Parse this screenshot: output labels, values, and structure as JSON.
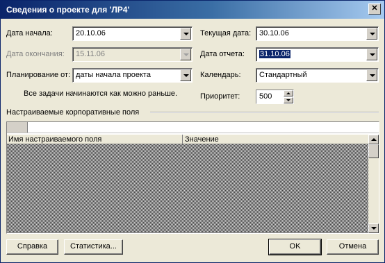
{
  "window": {
    "title": "Сведения о проекте для 'ЛР4'",
    "close_glyph": "✕"
  },
  "fields": {
    "start_date": {
      "label": "Дата начала:",
      "value": "20.10.06"
    },
    "finish_date": {
      "label": "Дата окончания:",
      "value": "15.11.06",
      "disabled": true
    },
    "schedule_from": {
      "label": "Планирование от:",
      "value": "даты начала проекта"
    },
    "current_date": {
      "label": "Текущая дата:",
      "value": "30.10.06"
    },
    "status_date": {
      "label": "Дата отчета:",
      "value": "31.10.06"
    },
    "calendar": {
      "label": "Календарь:",
      "value": "Стандартный"
    },
    "priority": {
      "label": "Приоритет:",
      "value": "500"
    }
  },
  "schedule_note": "Все задачи начинаются как можно раньше.",
  "custom_fields": {
    "group_label": "Настраиваемые корпоративные поля",
    "columns": [
      "Имя настраиваемого поля",
      "Значение"
    ]
  },
  "buttons": {
    "help": "Справка",
    "statistics": "Статистика...",
    "ok": "OK",
    "cancel": "Отмена"
  },
  "colors": {
    "title_start": "#0a246a",
    "title_end": "#a6caf0",
    "dialog_bg": "#ece9d8",
    "selection": "#0a246a"
  },
  "icons": {
    "close": "close-icon",
    "dropdown": "chevron-down-icon",
    "spin": "spin-arrows-icon"
  }
}
